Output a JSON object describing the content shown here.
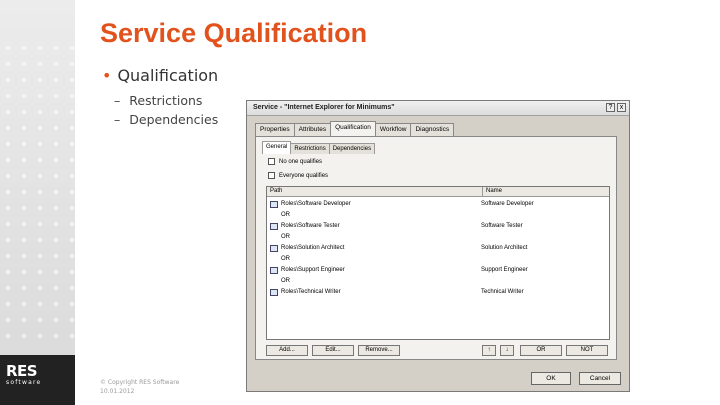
{
  "slide": {
    "title": "Service Qualification",
    "bullets": {
      "main": "Qualification",
      "subs": [
        "Restrictions",
        "Dependencies"
      ]
    },
    "footer": [
      "© Copyright RES Software",
      "10.01.2012"
    ],
    "logo": {
      "name": "RES",
      "tagline": "software"
    },
    "accent_color": "#e2521d"
  },
  "dialog": {
    "title": "Service - \"Internet Explorer for Minimums\"",
    "window_buttons": [
      "?",
      "x"
    ],
    "tabs": [
      "Properties",
      "Attributes",
      "Qualification",
      "Workflow",
      "Diagnostics"
    ],
    "active_tab": "Qualification",
    "subtabs": [
      "General",
      "Restrictions",
      "Dependencies"
    ],
    "active_subtab": "General",
    "checkboxes": [
      "No one qualifies",
      "Everyone qualifies"
    ],
    "list": {
      "columns": [
        "Path",
        "Name"
      ],
      "rows": [
        {
          "path": "Roles\\Software Developer",
          "name": "Software Developer"
        },
        {
          "path": "Roles\\Software Tester",
          "name": "Software Tester"
        },
        {
          "path": "Roles\\Solution Architect",
          "name": "Solution Architect"
        },
        {
          "path": "Roles\\Support Engineer",
          "name": "Support Engineer"
        },
        {
          "path": "Roles\\Technical Writer",
          "name": "Technical Writer"
        }
      ],
      "separator": "OR"
    },
    "panel_buttons": [
      "Add...",
      "Edit...",
      "Remove...",
      "↑",
      "↓",
      "OR",
      "NOT"
    ],
    "ok_label": "OK",
    "cancel_label": "Cancel"
  }
}
